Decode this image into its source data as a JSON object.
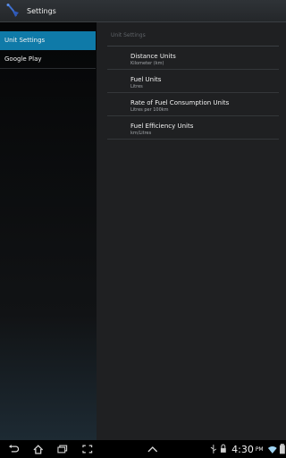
{
  "action_bar": {
    "title": "Settings",
    "icon": "fuel-app-icon"
  },
  "nav": {
    "items": [
      {
        "label": "Unit Settings",
        "active": true
      },
      {
        "label": "Google Play",
        "active": false
      }
    ]
  },
  "content": {
    "section_header": "Unit Settings",
    "preferences": [
      {
        "title": "Distance Units",
        "summary": "Kilometer (km)"
      },
      {
        "title": "Fuel Units",
        "summary": "Litres"
      },
      {
        "title": "Rate of Fuel Consumption Units",
        "summary": "Litres per 100km"
      },
      {
        "title": "Fuel Efficiency Units",
        "summary": "km/Litres"
      }
    ]
  },
  "system_bar": {
    "time": "4:30",
    "ampm": "PM",
    "icons": [
      "back-icon",
      "home-icon",
      "recent-apps-icon",
      "screenshot-icon",
      "up-icon",
      "usb-icon",
      "lock-icon",
      "wifi-icon",
      "battery-icon"
    ]
  },
  "colors": {
    "accent": "#0f7aa8",
    "pane_background": "#1f2022",
    "action_bar": "#2b2e31"
  }
}
